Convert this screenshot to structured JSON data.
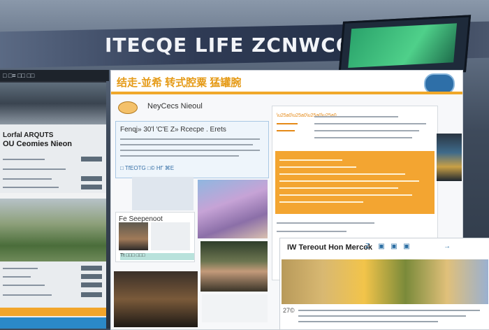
{
  "banner": {
    "title": "ITECQE LIFE ZCNWCQL"
  },
  "left_panel": {
    "top_bar_text": "□ □≡ □□ □□",
    "heading": "Lorfal ARQUTS",
    "subheading": "OU  Ceomies Nieon"
  },
  "main": {
    "header_title": "结走-並希 转式腔粟  猛罐腕",
    "site_title": "NeyCecs Nieoul",
    "blue_card_title": "Fenqj» 30'l ′C'Е Z» Rcecpe . Erets",
    "blue_card_link": "□ TfEOTG □© Hf’ ⌘E",
    "people_card_title": "Fe Seepenoot",
    "people_tag": "Tt □□□ □□□"
  },
  "bottom_right": {
    "title": "IW Tereout Hon Mercok",
    "icons": [
      "Z",
      "▣",
      "▣",
      "▣",
      "→"
    ],
    "caption": "27©"
  }
}
